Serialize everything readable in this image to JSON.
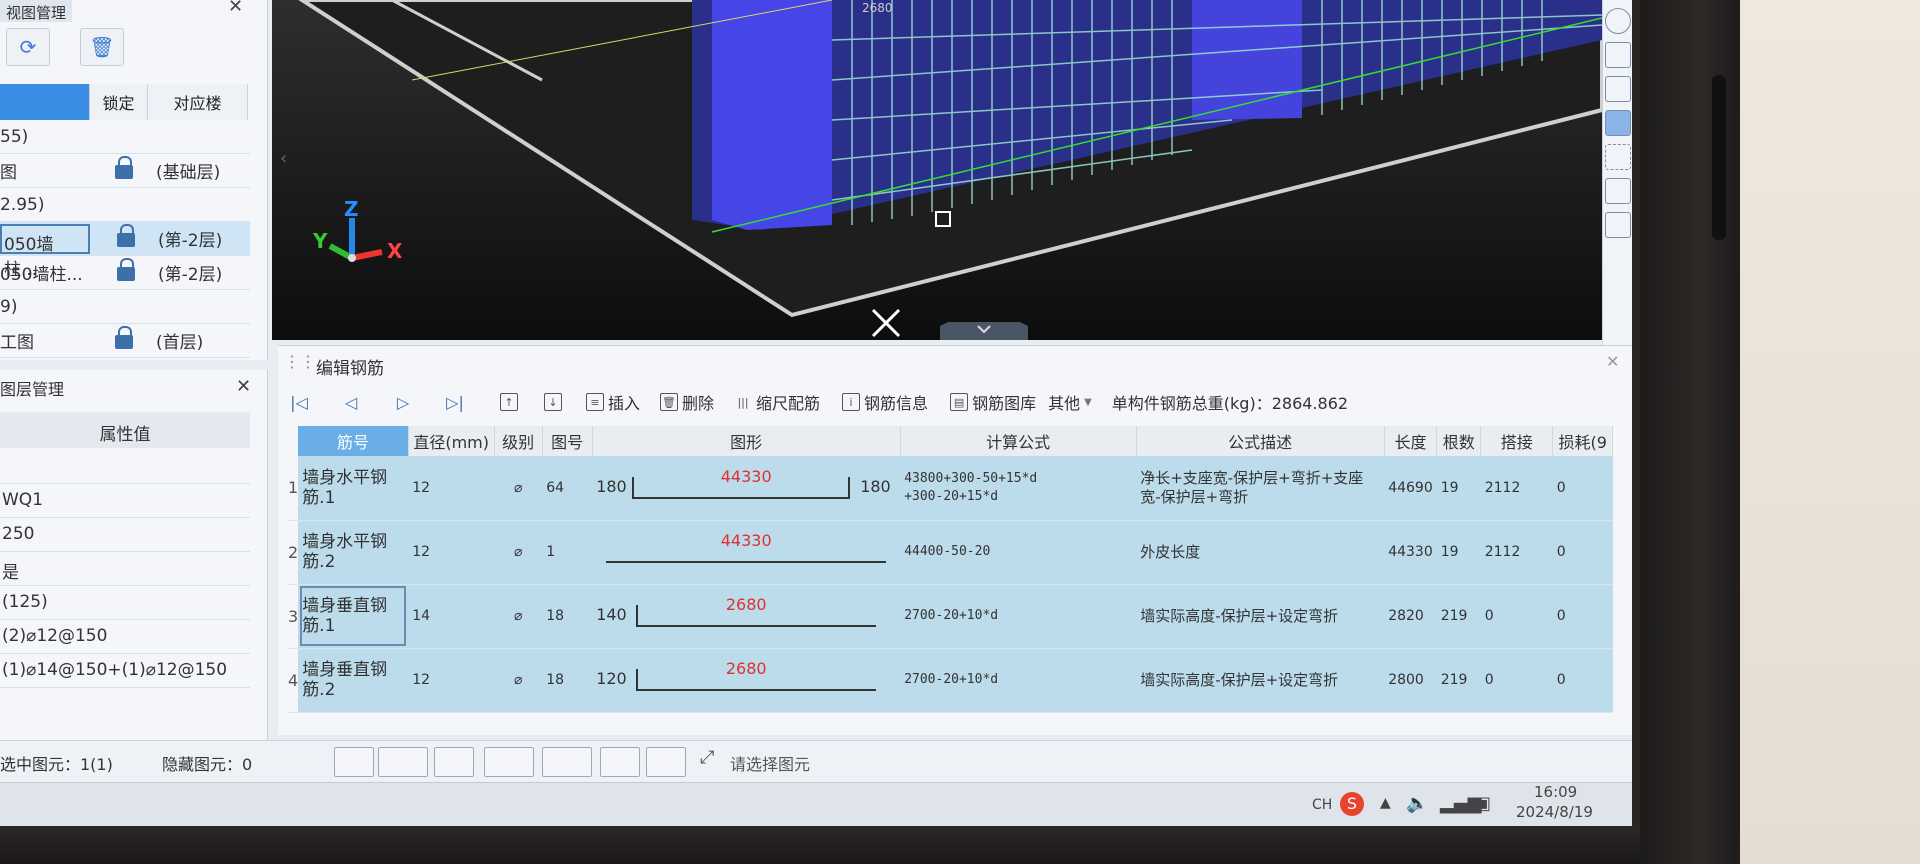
{
  "layer_panel": {
    "title": "视图管理",
    "columns": [
      "",
      "锁定",
      "对应楼"
    ],
    "rows": [
      {
        "name": "55)",
        "lock": false,
        "floor": ""
      },
      {
        "name": "图",
        "lock": true,
        "floor": "(基础层)"
      },
      {
        "name": "2.95)",
        "lock": false,
        "floor": ""
      },
      {
        "name": "050墙柱...",
        "lock": true,
        "floor": "(第-2层)"
      },
      {
        "name": "050墙柱...",
        "lock": true,
        "floor": "(第-2层)"
      },
      {
        "name": "9)",
        "lock": false,
        "floor": ""
      },
      {
        "name": "工图",
        "lock": true,
        "floor": "(首层)"
      }
    ]
  },
  "prop_panel": {
    "title": "图层管理",
    "header": "属性值",
    "rows": [
      "",
      "WQ1",
      "250",
      "是",
      "(125)",
      "(2)⌀12@150",
      "(1)⌀14@150+(1)⌀12@150"
    ]
  },
  "viewport": {
    "axis_x": "X",
    "axis_y": "Y",
    "axis_z": "Z",
    "dim_label": "2680"
  },
  "rebar": {
    "title": "编辑钢筋",
    "toolbar": {
      "insert": "插入",
      "delete": "删除",
      "scale": "缩尺配筋",
      "info": "钢筋信息",
      "library": "钢筋图库",
      "other": "其他",
      "total_label": "单构件钢筋总重(kg)：2864.862"
    },
    "columns": [
      "筋号",
      "直径(mm)",
      "级别",
      "图号",
      "图形",
      "计算公式",
      "公式描述",
      "长度",
      "根数",
      "搭接",
      "损耗(9"
    ],
    "rows": [
      {
        "idx": "1",
        "name": "墙身水平钢筋.1",
        "dia": "12",
        "grade": "⌀",
        "fig": "64",
        "left": "180",
        "val": "44330",
        "right": "180",
        "formula": "43800+300-50+15*d\n+300-20+15*d",
        "desc": "净长+支座宽-保护层+弯折+支座宽-保护层+弯折",
        "len": "44690",
        "count": "19",
        "lap": "2112",
        "loss": "0"
      },
      {
        "idx": "2",
        "name": "墙身水平钢筋.2",
        "dia": "12",
        "grade": "⌀",
        "fig": "1",
        "left": "",
        "val": "44330",
        "right": "",
        "formula": "44400-50-20",
        "desc": "外皮长度",
        "len": "44330",
        "count": "19",
        "lap": "2112",
        "loss": "0"
      },
      {
        "idx": "3",
        "name": "墙身垂直钢筋.1",
        "dia": "14",
        "grade": "⌀",
        "fig": "18",
        "left": "140",
        "val": "2680",
        "right": "",
        "formula": "2700-20+10*d",
        "desc": "墙实际高度-保护层+设定弯折",
        "len": "2820",
        "count": "219",
        "lap": "0",
        "loss": "0"
      },
      {
        "idx": "4",
        "name": "墙身垂直钢筋.2",
        "dia": "12",
        "grade": "⌀",
        "fig": "18",
        "left": "120",
        "val": "2680",
        "right": "",
        "formula": "2700-20+10*d",
        "desc": "墙实际高度-保护层+设定弯折",
        "len": "2800",
        "count": "219",
        "lap": "0",
        "loss": "0"
      }
    ]
  },
  "status": {
    "selected": "选中图元：1(1)",
    "hidden": "隐藏图元：0",
    "hint": "请选择图元"
  },
  "taskbar": {
    "lang": "CH",
    "time": "16:09",
    "date": "2024/8/19"
  }
}
